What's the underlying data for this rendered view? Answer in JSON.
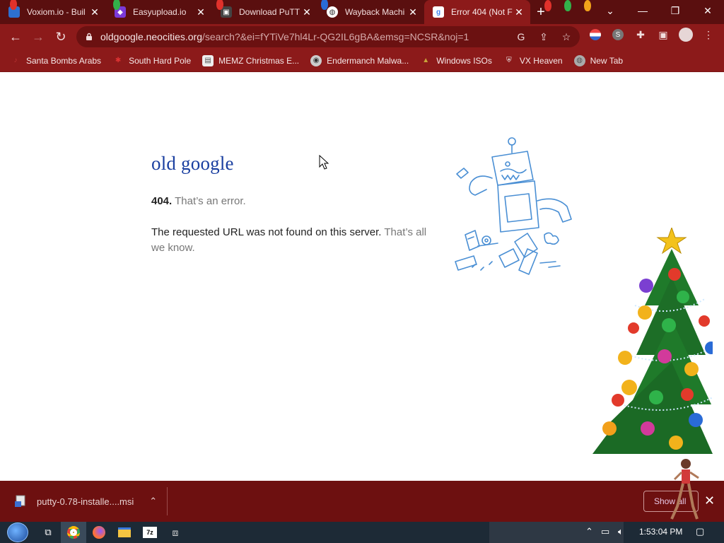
{
  "browser": {
    "tabs": [
      {
        "title": "Voxiom.io - Buil",
        "favicon_color": "#2d6fd0"
      },
      {
        "title": "Easyupload.io",
        "favicon_color": "#7b3ad9"
      },
      {
        "title": "Download PuTT",
        "favicon_color": "#444444"
      },
      {
        "title": "Wayback Machi",
        "favicon_color": "#ffffff"
      },
      {
        "title": "Error 404 (Not F",
        "favicon_color": "#4285f4"
      }
    ],
    "new_tab_label": "+",
    "address": {
      "host": "oldgoogle.neocities.org",
      "path": "/search?&ei=fYTiVe7hl4Lr-QG2IL6gBA&emsg=NCSR&noj=1"
    },
    "bookmarks": [
      {
        "label": "Santa Bombs Arabs",
        "icon": "ornament-icon"
      },
      {
        "label": "South Hard Pole",
        "icon": "snowflake-icon"
      },
      {
        "label": "MEMZ Christmas E...",
        "icon": "image-icon"
      },
      {
        "label": "Endermanch Malwa...",
        "icon": "raccoon-icon"
      },
      {
        "label": "Windows ISOs",
        "icon": "elf-icon"
      },
      {
        "label": "VX Heaven",
        "icon": "shield-icon"
      },
      {
        "label": "New Tab",
        "icon": "globe-icon"
      }
    ],
    "profile_letter": "S"
  },
  "page": {
    "logo": "old google",
    "error_code": "404.",
    "error_text": "That’s an error.",
    "message_main": "The requested URL was not found on this server.",
    "message_dim": "That’s all we know."
  },
  "downloads": {
    "file": "putty-0.78-installe....msi",
    "show_all": "Show all"
  },
  "taskbar": {
    "clock": "1:53:04 PM"
  },
  "colors": {
    "theme_dark": "#5a0f0f",
    "theme_toolbar": "#8c1a1a",
    "logo_blue": "#1a3fa0"
  }
}
